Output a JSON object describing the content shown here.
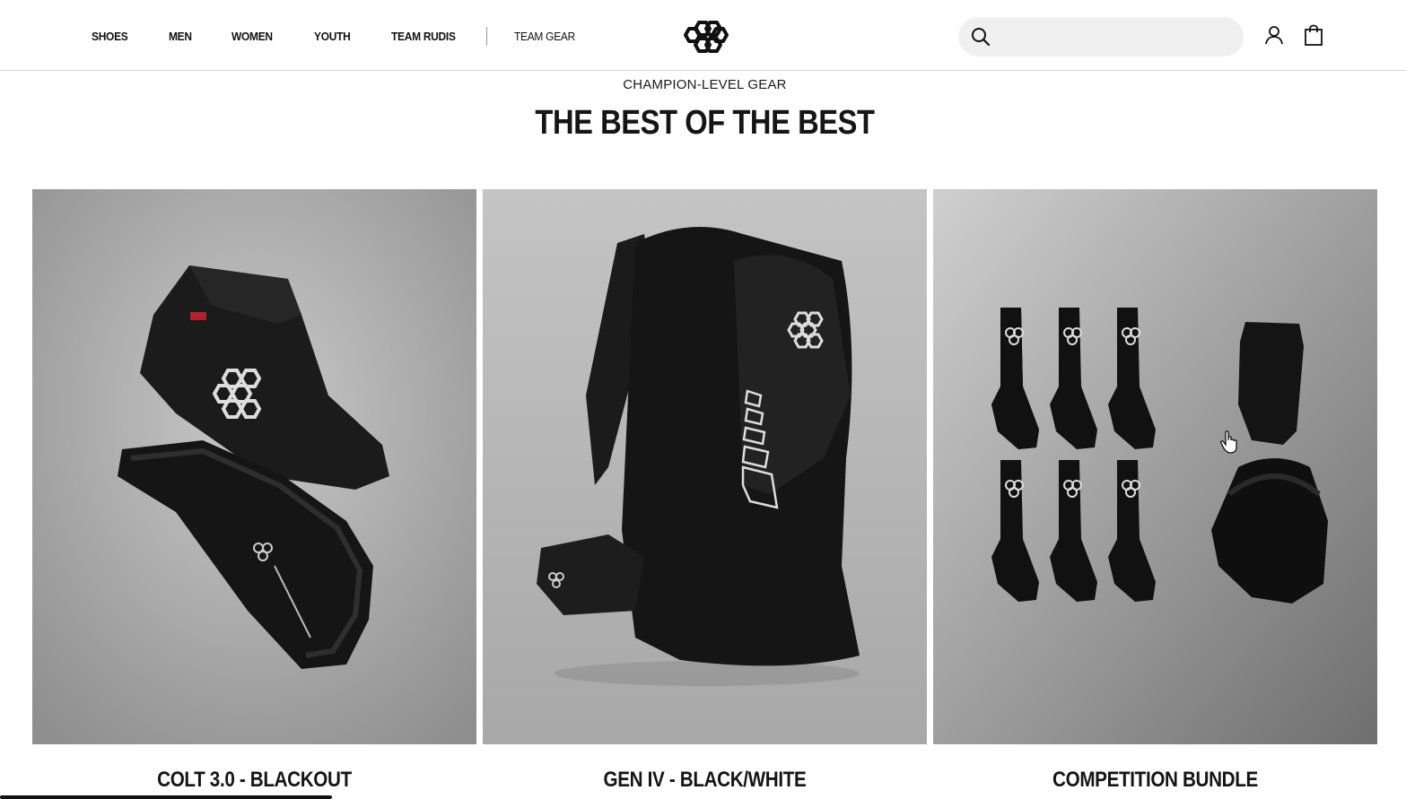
{
  "nav": {
    "items": [
      "SHOES",
      "MEN",
      "WOMEN",
      "YOUTH",
      "TEAM RUDIS"
    ],
    "secondary": "TEAM GEAR"
  },
  "brand": {
    "logo_icon": "hexagon-cluster-logo"
  },
  "search": {
    "value": "",
    "placeholder": ""
  },
  "section": {
    "eyebrow": "CHAMPION-LEVEL GEAR",
    "title": "THE BEST OF THE BEST"
  },
  "products": [
    {
      "name": "COLT 3.0 - BLACKOUT"
    },
    {
      "name": "GEN IV - BLACK/WHITE"
    },
    {
      "name": "COMPETITION BUNDLE"
    }
  ],
  "colors": {
    "text": "#111111",
    "search_bg": "#f0f0f0",
    "divider": "#d6d6d6"
  }
}
